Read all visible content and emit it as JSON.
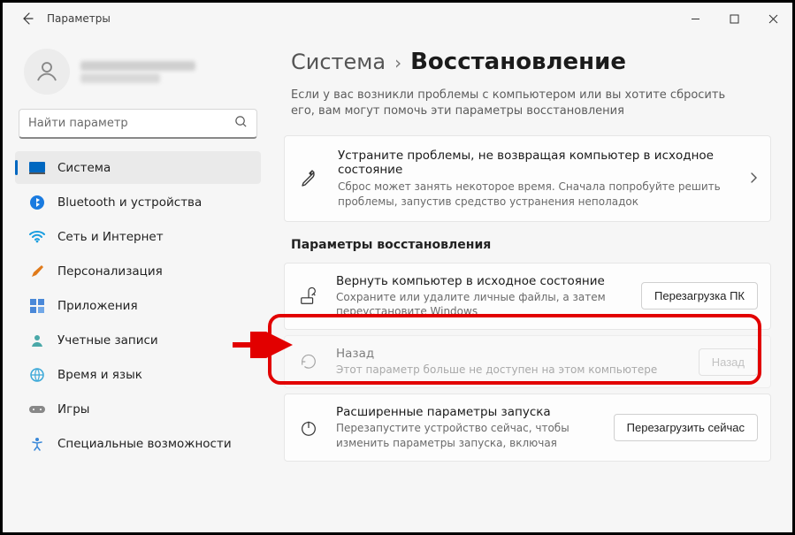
{
  "window": {
    "title": "Параметры"
  },
  "search": {
    "placeholder": "Найти параметр"
  },
  "nav": {
    "items": [
      {
        "label": "Система"
      },
      {
        "label": "Bluetooth и устройства"
      },
      {
        "label": "Сеть и Интернет"
      },
      {
        "label": "Персонализация"
      },
      {
        "label": "Приложения"
      },
      {
        "label": "Учетные записи"
      },
      {
        "label": "Время и язык"
      },
      {
        "label": "Игры"
      },
      {
        "label": "Специальные возможности"
      }
    ]
  },
  "breadcrumb": {
    "parent": "Система",
    "current": "Восстановление"
  },
  "intro": "Если у вас возникли проблемы с компьютером или вы хотите сбросить его, вам могут помочь эти параметры восстановления",
  "troubleshoot": {
    "title": "Устраните проблемы, не возвращая компьютер в исходное состояние",
    "sub": "Сброс может занять некоторое время. Сначала попробуйте решить проблемы, запустив средство устранения неполадок"
  },
  "section_header": "Параметры восстановления",
  "options": {
    "reset": {
      "title": "Вернуть компьютер в исходное состояние",
      "sub": "Сохраните или удалите личные файлы, а затем переустановите Windows",
      "button": "Перезагрузка ПК"
    },
    "goback": {
      "title": "Назад",
      "sub": "Этот параметр больше не доступен на этом компьютере",
      "button": "Назад"
    },
    "advanced": {
      "title": "Расширенные параметры запуска",
      "sub": "Перезапустите устройство сейчас, чтобы изменить параметры запуска, включая",
      "button": "Перезагрузить сейчас"
    }
  }
}
